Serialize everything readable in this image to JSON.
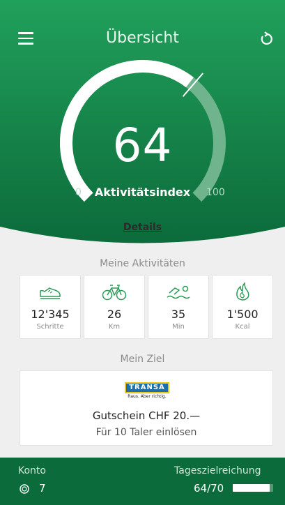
{
  "header": {
    "title": "Übersicht",
    "menu_icon": "hamburger-menu-icon",
    "refresh_icon": "refresh-icon",
    "gradient_top": "#21a05b",
    "gradient_bottom": "#0c6b3b"
  },
  "gauge": {
    "value": "64",
    "label": "Aktivitätsindex",
    "min": "0",
    "max": "100",
    "fraction": 0.64
  },
  "details_link": "Details",
  "activities": {
    "title": "Meine Aktivitäten",
    "items": [
      {
        "icon": "shoe-icon",
        "value": "12'345",
        "unit": "Schritte"
      },
      {
        "icon": "bicycle-icon",
        "value": "26",
        "unit": "Km"
      },
      {
        "icon": "swimmer-icon",
        "value": "35",
        "unit": "Min"
      },
      {
        "icon": "flame-icon",
        "value": "1'500",
        "unit": "Kcal"
      }
    ]
  },
  "goal": {
    "title": "Mein Ziel",
    "logo_text": "TRANSA",
    "logo_tagline": "Raus. Aber richtig.",
    "voucher": "Gutschein CHF 20.—",
    "redeem": "Für 10 Taler einlösen"
  },
  "footer": {
    "konto_label": "Konto",
    "konto_icon": "coin-icon",
    "konto_value": "7",
    "tz_label": "Tageszielreichung",
    "tz_value": "64/70",
    "tz_fraction": 0.914
  },
  "colors": {
    "accent_green": "#0c6b3b",
    "background": "#efefef"
  }
}
